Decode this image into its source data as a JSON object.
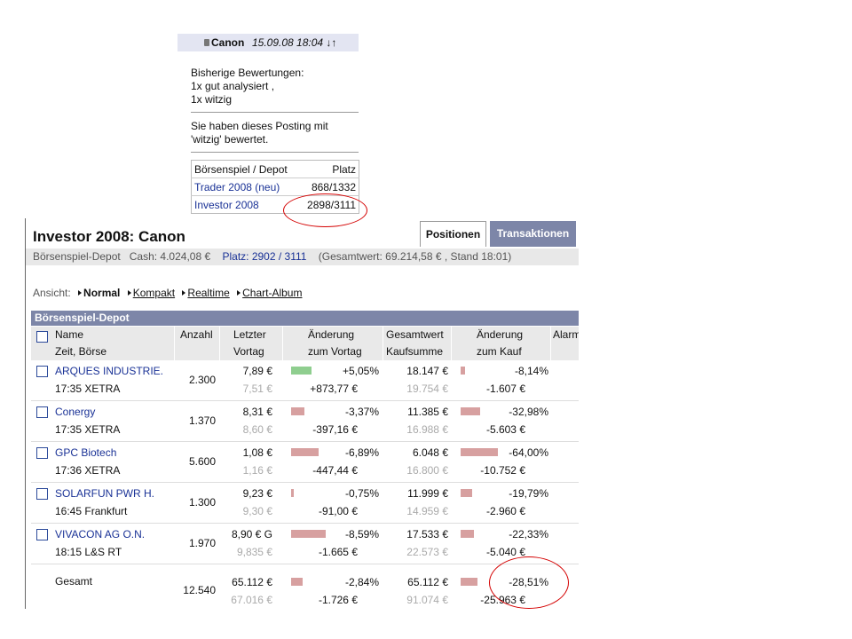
{
  "posting": {
    "author": "Canon",
    "datetime": "15.09.08 18:04",
    "arrows": "↓↑",
    "ratings_heading": "Bisherige Bewertungen:",
    "ratings": [
      "1x gut analysiert ,",
      "1x witzig"
    ],
    "user_rated_line1": "Sie haben dieses Posting mit",
    "user_rated_line2": "'witzig' bewertet.",
    "table": {
      "header": {
        "game": "Börsenspiel / Depot",
        "rank": "Platz"
      },
      "rows": [
        {
          "game": "Trader 2008 (neu)",
          "rank": "868/1332"
        },
        {
          "game": "Investor 2008",
          "rank": "2898/3111"
        }
      ]
    }
  },
  "investor": {
    "title": "Investor 2008: Canon",
    "tabs": {
      "active": "Positionen",
      "inactive": "Transaktionen"
    },
    "info": {
      "depot_label": "Börsenspiel-Depot",
      "cash": "Cash: 4.024,08 €",
      "platz": "Platz: 2902 / 3111",
      "total": "(Gesamtwert: 69.214,58 € , Stand 18:01)"
    },
    "view": {
      "label": "Ansicht:",
      "options": [
        "Normal",
        "Kompakt",
        "Realtime",
        "Chart-Album"
      ]
    },
    "section_title": "Börsenspiel-Depot",
    "columns": {
      "name": "Name",
      "name2": "Zeit, Börse",
      "anzahl": "Anzahl",
      "letzter": "Letzter",
      "letzter2": "Vortag",
      "aenderung": "Änderung",
      "aenderung2": "zum Vortag",
      "gesamtwert": "Gesamtwert",
      "gesamtwert2": "Kaufsumme",
      "aenderung_kauf": "Änderung",
      "aenderung_kauf2": "zum Kauf",
      "alarm": "Alarm"
    },
    "positions": [
      {
        "name": "ARQUES INDUSTRIE.",
        "time_exchange": "17:35 XETRA",
        "anzahl": "2.300",
        "letzter": "7,89 €",
        "vortag": "7,51 €",
        "chg_pct": "+5,05%",
        "chg_abs": "+873,77 €",
        "gesamtwert": "18.147 €",
        "kaufsumme": "19.754 €",
        "buy_pct": "-8,14%",
        "buy_abs": "-1.607 €",
        "bar_day": 5.05,
        "bar_buy": -8.14
      },
      {
        "name": "Conergy",
        "time_exchange": "17:35 XETRA",
        "anzahl": "1.370",
        "letzter": "8,31 €",
        "vortag": "8,60 €",
        "chg_pct": "-3,37%",
        "chg_abs": "-397,16 €",
        "gesamtwert": "11.385 €",
        "kaufsumme": "16.988 €",
        "buy_pct": "-32,98%",
        "buy_abs": "-5.603 €",
        "bar_day": -3.37,
        "bar_buy": -32.98
      },
      {
        "name": "GPC Biotech",
        "time_exchange": "17:36 XETRA",
        "anzahl": "5.600",
        "letzter": "1,08 €",
        "vortag": "1,16 €",
        "chg_pct": "-6,89%",
        "chg_abs": "-447,44 €",
        "gesamtwert": "6.048 €",
        "kaufsumme": "16.800 €",
        "buy_pct": "-64,00%",
        "buy_abs": "-10.752 €",
        "bar_day": -6.89,
        "bar_buy": -64.0
      },
      {
        "name": "SOLARFUN PWR H.",
        "time_exchange": "16:45 Frankfurt",
        "anzahl": "1.300",
        "letzter": "9,23 €",
        "vortag": "9,30 €",
        "chg_pct": "-0,75%",
        "chg_abs": "-91,00 €",
        "gesamtwert": "11.999 €",
        "kaufsumme": "14.959 €",
        "buy_pct": "-19,79%",
        "buy_abs": "-2.960 €",
        "bar_day": -0.75,
        "bar_buy": -19.79
      },
      {
        "name": "VIVACON AG O.N.",
        "time_exchange": "18:15 L&S RT",
        "anzahl": "1.970",
        "letzter": "8,90 € G",
        "vortag": "9,835 €",
        "chg_pct": "-8,59%",
        "chg_abs": "-1.665 €",
        "gesamtwert": "17.533 €",
        "kaufsumme": "22.573 €",
        "buy_pct": "-22,33%",
        "buy_abs": "-5.040 €",
        "bar_day": -8.59,
        "bar_buy": -22.33
      }
    ],
    "total": {
      "label": "Gesamt",
      "anzahl": "12.540",
      "letzter": "65.112 €",
      "vortag": "67.016 €",
      "chg_pct": "-2,84%",
      "chg_abs": "-1.726 €",
      "gesamtwert": "65.112 €",
      "kaufsumme": "91.074 €",
      "buy_pct": "-28,51%",
      "buy_abs": "-25.963 €",
      "bar_day": -2.84,
      "bar_buy": -28.51
    }
  },
  "colors": {
    "highlight_circle": "#d40000",
    "bar_positive": "#8fce8f",
    "bar_negative": "#d7a0a0",
    "section_header": "#7d86a8"
  }
}
